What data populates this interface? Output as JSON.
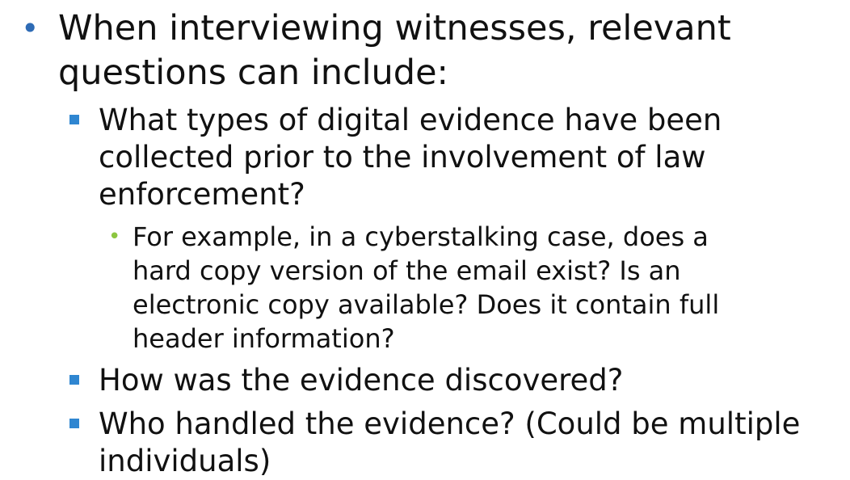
{
  "colors": {
    "level1_bullet": "#2e6bb5",
    "level2_bullet": "#2f86d1",
    "level3_bullet": "#8cc63f",
    "text": "#111111",
    "background": "#ffffff"
  },
  "slide": {
    "items": [
      {
        "level": 1,
        "text": "When interviewing witnesses, relevant\nquestions can include:"
      },
      {
        "level": 2,
        "text": "What types of digital evidence have been\ncollected prior to the involvement of law\nenforcement?"
      },
      {
        "level": 3,
        "text": "For example, in a cyberstalking case, does a\nhard copy version of the email exist? Is an\nelectronic copy available? Does it contain full\nheader information?"
      },
      {
        "level": 2,
        "text": "How was the evidence discovered?"
      },
      {
        "level": 2,
        "text": "Who handled the evidence? (Could be multiple\nindividuals)"
      }
    ]
  }
}
